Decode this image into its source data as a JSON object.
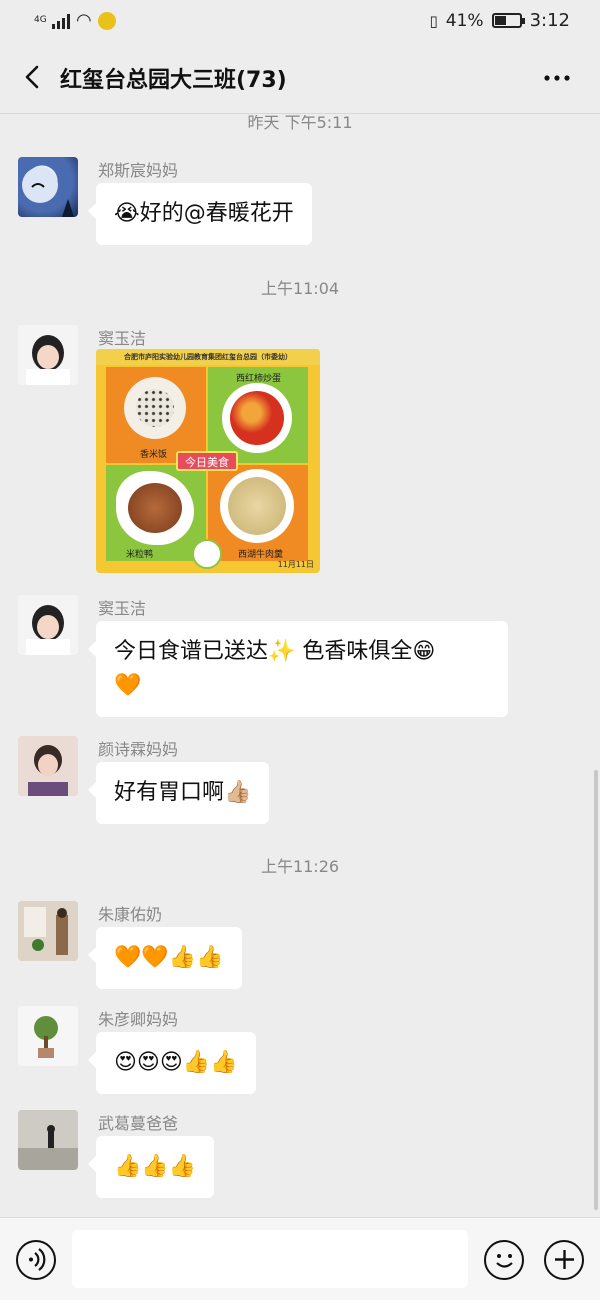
{
  "status_bar": {
    "network": "4G",
    "battery": "41%",
    "time": "3:12"
  },
  "header": {
    "back_icon": "chevron-left",
    "title": "红玺台总园大三班(73)",
    "more_icon": "more-dots"
  },
  "messages": [
    {
      "type": "timestamp",
      "text": "昨天 下午5:11"
    },
    {
      "type": "text",
      "sender": "郑斯宸妈妈",
      "avatar": "moon-avatar",
      "emoji_prefix": "😭",
      "text": "好的@春暖花开"
    },
    {
      "type": "timestamp",
      "text": "上午11:04"
    },
    {
      "type": "image",
      "sender": "窦玉洁",
      "avatar": "girl-avatar",
      "image": {
        "header": "合肥市庐阳实验幼儿园教育集团红玺台总园（市委幼）",
        "badge": "今日美食",
        "labels": [
          "香米饭",
          "西红柿炒蛋",
          "米粒鸭",
          "西湖牛肉羹"
        ],
        "date": "11月11日"
      }
    },
    {
      "type": "text",
      "sender": "窦玉洁",
      "avatar": "girl-avatar",
      "text": "今日食谱已送达✨ 色香味俱全😁",
      "text_line2": "🧡"
    },
    {
      "type": "text",
      "sender": "颜诗霖妈妈",
      "avatar": "portrait-avatar",
      "text": "好有胃口啊👍🏼"
    },
    {
      "type": "timestamp",
      "text": "上午11:26"
    },
    {
      "type": "text",
      "sender": "朱康佑奶",
      "avatar": "room-avatar",
      "text": "🧡🧡👍👍"
    },
    {
      "type": "text",
      "sender": "朱彦卿妈妈",
      "avatar": "plant-avatar",
      "text": "😍😍😍👍👍"
    },
    {
      "type": "text",
      "sender": "武葛蔓爸爸",
      "avatar": "outdoor-avatar",
      "text": "👍👍👍"
    }
  ],
  "input_bar": {
    "voice_icon": "voice-icon",
    "emoji_icon": "emoji-icon",
    "plus_icon": "plus-icon",
    "input_value": ""
  },
  "colors": {
    "background": "#ededed",
    "bubble": "#ffffff",
    "timestamp": "#888888"
  }
}
